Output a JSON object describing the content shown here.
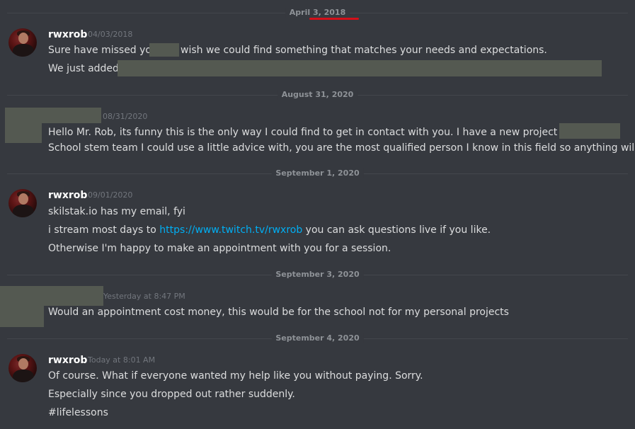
{
  "dividers": [
    "April 3, 2018",
    "August 31, 2020",
    "September 1, 2020",
    "September 3, 2020",
    "September 4, 2020"
  ],
  "groups": [
    {
      "author": "rwxrob",
      "timestamp": "04/03/2018",
      "lines": [
        {
          "before": "Sure have missed you",
          "after": "wish we could find something that matches your needs and expectations."
        },
        {
          "text": "We just added"
        }
      ]
    },
    {
      "author": "",
      "timestamp": "08/31/2020",
      "lines": [
        {
          "text": "Hello Mr. Rob, its funny this is the only way I could find to get in contact with you. I have a new project for the"
        },
        {
          "text": "School stem team I could use a little advice with, you are the most qualified person I know in this field so anything will help."
        }
      ]
    },
    {
      "author": "rwxrob",
      "timestamp": "09/01/2020",
      "lines": [
        {
          "text": "skilstak.io has my email, fyi"
        },
        {
          "before": "i stream most days to",
          "link": "https://www.twitch.tv/rwxrob",
          "after": "you can ask questions live if you like."
        },
        {
          "text": "Otherwise I'm happy to make an appointment with you for a session."
        }
      ]
    },
    {
      "author": "",
      "timestamp": "Yesterday at 8:47 PM",
      "lines": [
        {
          "text": "Would an appointment cost money, this would be for the school not for my personal projects"
        }
      ]
    },
    {
      "author": "rwxrob",
      "timestamp": "Today at 8:01 AM",
      "lines": [
        {
          "text": "Of course. What if everyone wanted my help like you without paying. Sorry."
        },
        {
          "text": "Especially since you dropped out rather suddenly."
        },
        {
          "text": "#lifelessons"
        }
      ]
    }
  ],
  "colors": {
    "background": "#36393f",
    "text": "#dcddde",
    "timestamp": "#72767d",
    "link": "#00aff4",
    "redaction": "#545951",
    "date_underline": "#d4101a"
  }
}
